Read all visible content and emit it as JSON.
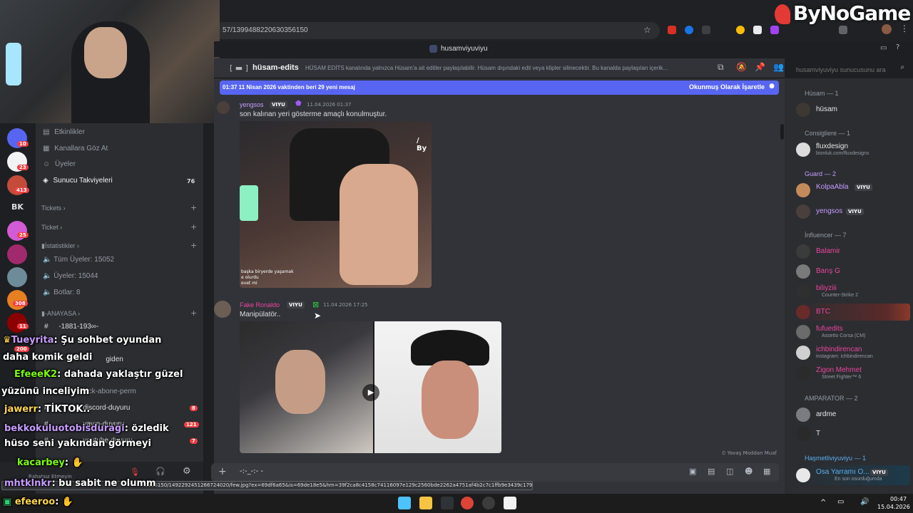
{
  "browser": {
    "url": "57/1399488220630356150",
    "brand_logo": "ByNoGame"
  },
  "title_strip": {
    "server_name": "husamviyuviyu"
  },
  "channel_header": {
    "channel_name": "hüsam-edits",
    "description": "HÜSAM EDİTS kanalında yalnızca Hüsam'a ait editler paylaşılabilir. Hüsam dışındaki edit veya klipler silinecektir. Bu kanalda paylaşılan içerik...",
    "search_placeholder": "husamviyuviyu sunucusunu ara"
  },
  "new_messages_bar": {
    "text": "01:37 11 Nisan 2026 vaktinden beri 29 yeni mesaj",
    "action": "Okunmuş Olarak İşaretle"
  },
  "server_list": {
    "badges": [
      "10",
      "23",
      "413",
      "25",
      "308",
      "11",
      "200"
    ],
    "bk_label": "BK"
  },
  "channel_list": {
    "top_items": [
      {
        "label": "Etkinlikler"
      },
      {
        "label": "Kanallara Göz At"
      },
      {
        "label": "Üyeler"
      },
      {
        "label": "Sunucu Takviyeleri",
        "count": "76"
      }
    ],
    "categories": [
      "Tickets",
      "Ticket",
      "İstatistikler",
      "ANAYASA"
    ],
    "stats": [
      "Tüm Üyeler: 15052",
      "Üyeler: 15044",
      "Botlar: 8"
    ],
    "channels": [
      {
        "label": "-1881-193∞-"
      },
      {
        "label": "giden"
      },
      {
        "label": "kick-abone-perm"
      },
      {
        "label": "discord-duyuru",
        "count": "8"
      },
      {
        "label": "yayın-duyuru",
        "count": "121"
      },
      {
        "label": "youtube-duyuru",
        "count": "7"
      }
    ],
    "user_status": "Rahatsız Etmeyin"
  },
  "messages": [
    {
      "author": "yengsos",
      "tag": "VIYU",
      "timestamp": "11.04.2026 01:37",
      "text": "son kalınan yeri gösterme amaçlı konulmuştur.",
      "image_caption": "başka biryerde yaşamak\ne olurdu\nevet mi"
    },
    {
      "author": "Fake Ronaldo",
      "tag": "VIYU",
      "timestamp": "11.04.2026 17:25",
      "text": "Manipülatör.."
    }
  ],
  "slow_mode": "Yavaş Moddan Muaf",
  "composer": {
    "text": "-:-_-:-  -"
  },
  "members": {
    "groups": [
      {
        "title": "Hüsam — 1",
        "items": [
          {
            "name": "hüsam",
            "color": "#e6e6e6"
          }
        ]
      },
      {
        "title": "Consigliere — 1",
        "items": [
          {
            "name": "fluxdesign",
            "sub": "bionluk.com/fluxdesigns",
            "color": "#e6e6e6"
          }
        ]
      },
      {
        "title": "Guard — 2",
        "items": [
          {
            "name": "KolpaAbla",
            "tag": "VIYU",
            "color": "#c79cff"
          },
          {
            "name": "yengsos",
            "tag": "VIYU",
            "color": "#c79cff"
          }
        ]
      },
      {
        "title": "İnfluencer — 7",
        "items": [
          {
            "name": "Balamir",
            "color": "#eb459e"
          },
          {
            "name": "Barış G",
            "color": "#eb459e"
          },
          {
            "name": "biliyziii",
            "sub": "Counter-Strike 2",
            "color": "#eb459e"
          },
          {
            "name": "BTC",
            "color": "#eb459e"
          },
          {
            "name": "fufuedits",
            "sub": "Assetto Corsa (CM)",
            "color": "#eb459e"
          },
          {
            "name": "ichbindirencan",
            "sub": "instagram: ichbindirencan",
            "color": "#eb459e"
          },
          {
            "name": "Zigon Mehmet",
            "sub": "Street Fighter™ 6",
            "color": "#eb459e"
          }
        ]
      },
      {
        "title": "AMPARATOR — 2",
        "items": [
          {
            "name": "ardme",
            "color": "#e6e6e6"
          },
          {
            "name": "T",
            "color": "#e6e6e6"
          }
        ]
      },
      {
        "title": "Haşmetliviyuviyu — 1",
        "items": [
          {
            "name": "Osa Yarramı O...",
            "tag": "VIYU",
            "sub": "En son osurduğumda",
            "color": "#5dadec"
          }
        ]
      }
    ]
  },
  "stream_chat": [
    {
      "user": "Tueyrita",
      "text": ": Şu sohbet oyundan",
      "color": "#c79cff"
    },
    {
      "user": "",
      "text": "daha komik geldi",
      "color": "#fff"
    },
    {
      "user": "EfeeeK2",
      "text": ": dahada yaklaştır güzel",
      "color": "#7cfc00"
    },
    {
      "user": "",
      "text": "yüzünü inceliyim",
      "color": "#fff"
    },
    {
      "user": "jawerr",
      "text": ": TİKTOK..",
      "color": "#ffd54a"
    },
    {
      "user": "bekkokuluotobisduragi",
      "text": ": özledik",
      "color": "#c79cff"
    },
    {
      "user": "",
      "text": "hüso seni yakından görmeyi",
      "color": "#fff"
    },
    {
      "user": "kacarbey",
      "text": ":",
      "color": "#7cfc00"
    },
    {
      "user": "mhtklnkr",
      "text": ": bu sabit ne olumm",
      "color": "#c79cff"
    },
    {
      "user": "efeeroo",
      "text": ":",
      "color": "#ffd54a"
    }
  ],
  "status_url": "0356150/1492292451266724020/few.jpg?ex=69df6a65&is=69de18e5&hm=39f2ca8c4158c74116097e129c2560bde2262a4751af4b2c7c1ffb9e3439c179&",
  "taskbar": {
    "time": "00:47",
    "date": "15.04.2026"
  },
  "colors": {
    "accent": "#5865f2",
    "danger": "#f23f43",
    "bg": "#313338"
  }
}
